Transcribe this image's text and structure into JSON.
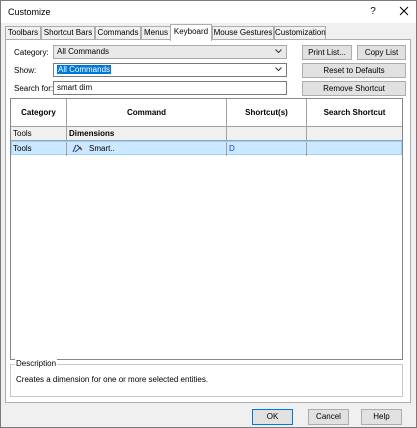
{
  "window": {
    "title": "Customize",
    "help_label": "?"
  },
  "tabs": [
    {
      "label": "Toolbars"
    },
    {
      "label": "Shortcut Bars"
    },
    {
      "label": "Commands"
    },
    {
      "label": "Menus"
    },
    {
      "label": "Keyboard",
      "active": true
    },
    {
      "label": "Mouse Gestures"
    },
    {
      "label": "Customization"
    }
  ],
  "filters": {
    "category_label": "Category:",
    "category_value": "All Commands",
    "show_label": "Show:",
    "show_value": "All Commands",
    "search_label": "Search for:",
    "search_value": "smart dim"
  },
  "buttons": {
    "print_list": "Print List...",
    "copy_list": "Copy List",
    "reset_defaults": "Reset to Defaults",
    "remove_shortcut": "Remove Shortcut",
    "ok": "OK",
    "cancel": "Cancel",
    "help": "Help"
  },
  "table": {
    "headers": [
      "Category",
      "Command",
      "Shortcut(s)",
      "Search Shortcut"
    ],
    "rows": [
      {
        "category": "Tools",
        "command": "Dimensions",
        "shortcut": "",
        "search": ""
      },
      {
        "category": "Tools",
        "command": "Smart..",
        "icon": "smart-dimension-icon",
        "shortcut": "D",
        "search": ""
      }
    ]
  },
  "description": {
    "title": "Description",
    "text": "Creates a dimension for one or more selected entities."
  },
  "colors": {
    "selection_highlight": "#0078d7",
    "selected_row": "#cce8ff",
    "shortcut_text": "#1a3fb8"
  }
}
